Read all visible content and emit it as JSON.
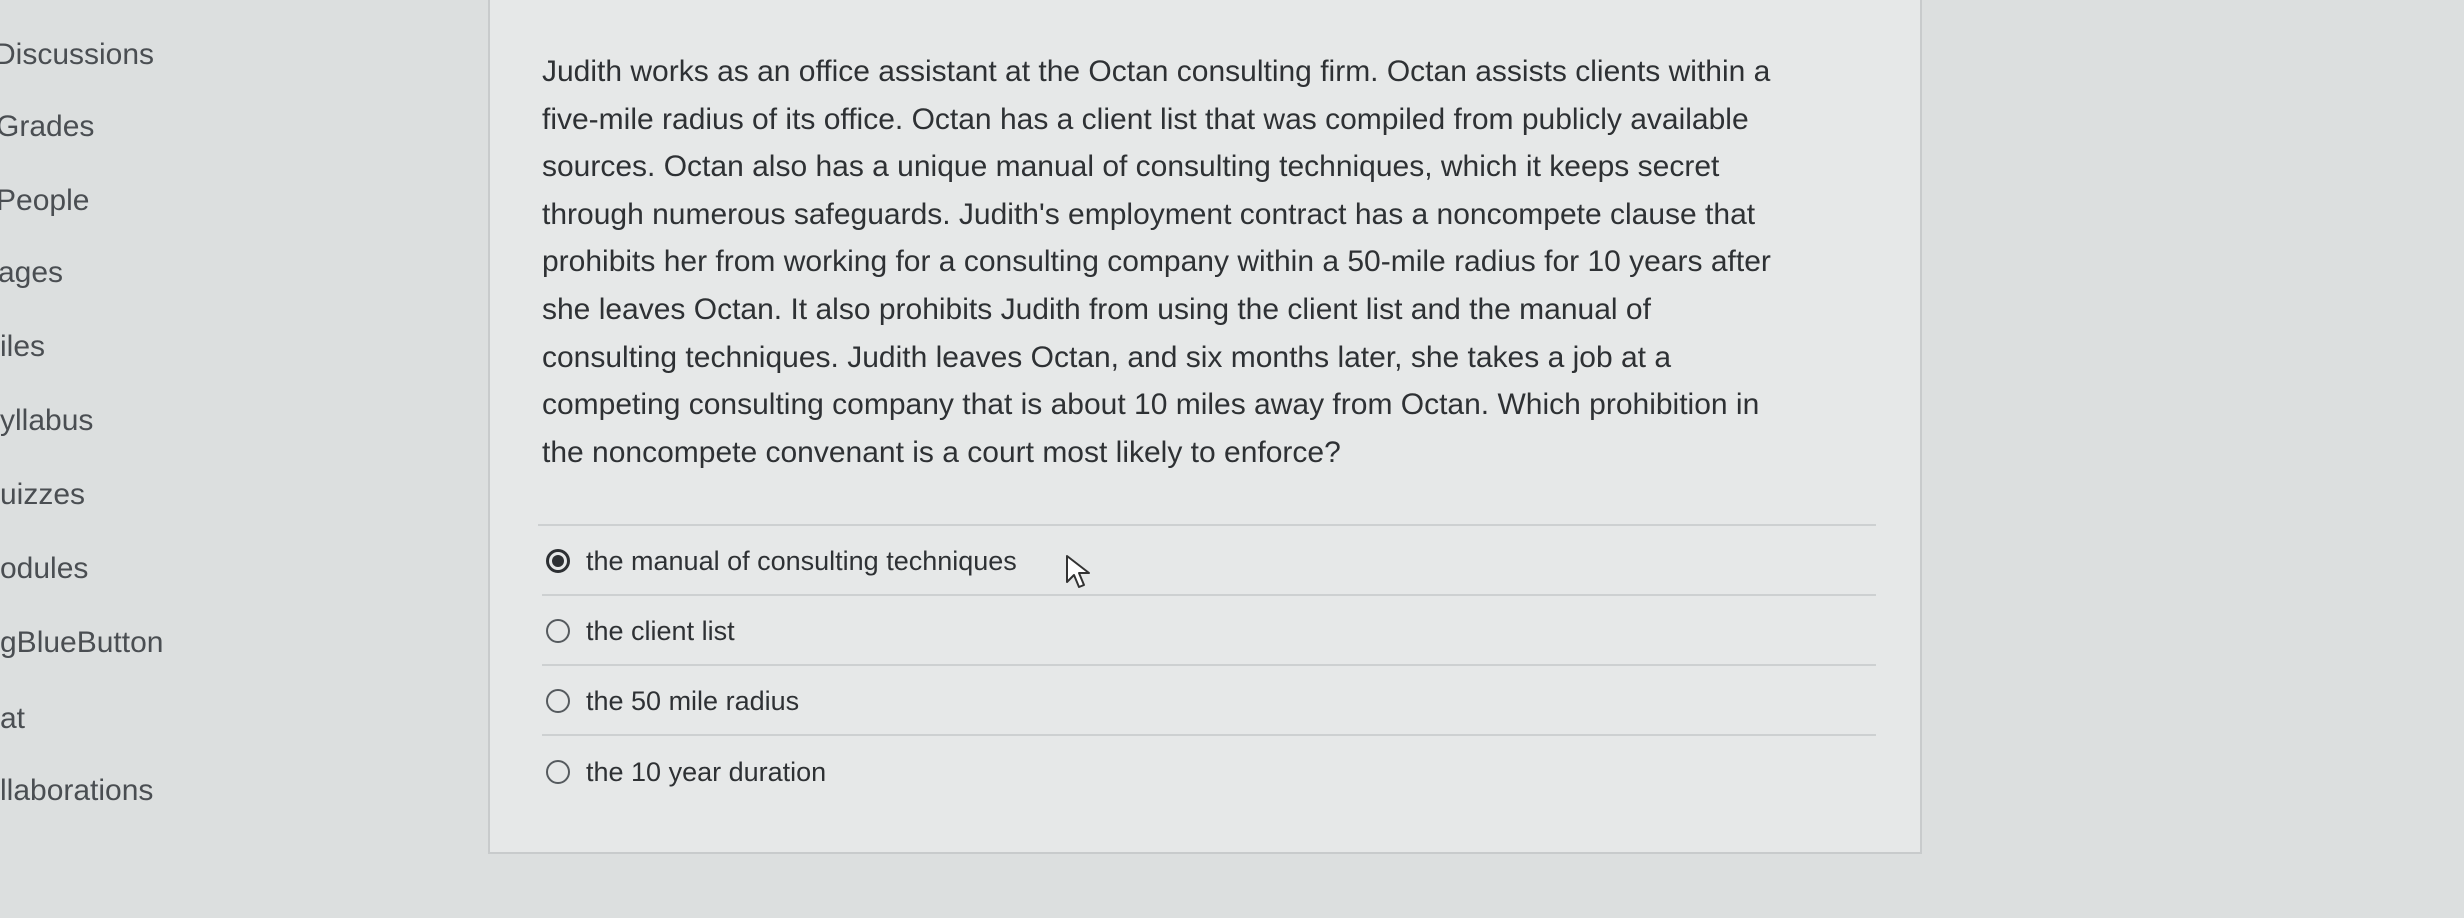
{
  "sidebar": {
    "items": [
      {
        "label": "Discussions"
      },
      {
        "label": "Grades"
      },
      {
        "label": "People"
      },
      {
        "label": "ages"
      },
      {
        "label": "iles"
      },
      {
        "label": "yllabus"
      },
      {
        "label": "uizzes"
      },
      {
        "label": "odules"
      },
      {
        "label": "gBlueButton"
      },
      {
        "label": "at"
      },
      {
        "label": "llaborations"
      }
    ]
  },
  "question": {
    "lines": [
      "Judith works as an office assistant at the Octan consulting firm.  Octan assists clients within a",
      "five-mile radius of its office. Octan has a client list that was compiled from publicly available",
      "sources. Octan also has a unique manual of consulting techniques, which it keeps secret",
      "through numerous safeguards.  Judith's employment contract has a noncompete clause that",
      "prohibits her from working for a consulting company within a 50-mile radius for 10 years after",
      "she leaves Octan.  It also prohibits Judith from using the client list and the manual of",
      "consulting techniques.  Judith leaves Octan, and six months later, she takes a job at a",
      "competing consulting company that is about 10 miles away from Octan.  Which prohibition in",
      "the noncompete convenant is a court most likely to enforce?"
    ],
    "answers": [
      {
        "label": "the manual of consulting techniques",
        "selected": true
      },
      {
        "label": "the client list",
        "selected": false
      },
      {
        "label": "the 50 mile radius",
        "selected": false
      },
      {
        "label": "the 10 year duration",
        "selected": false
      }
    ]
  },
  "icons": {
    "cursor": "pointer-arrow-icon",
    "radio": "radio-button-icon"
  }
}
